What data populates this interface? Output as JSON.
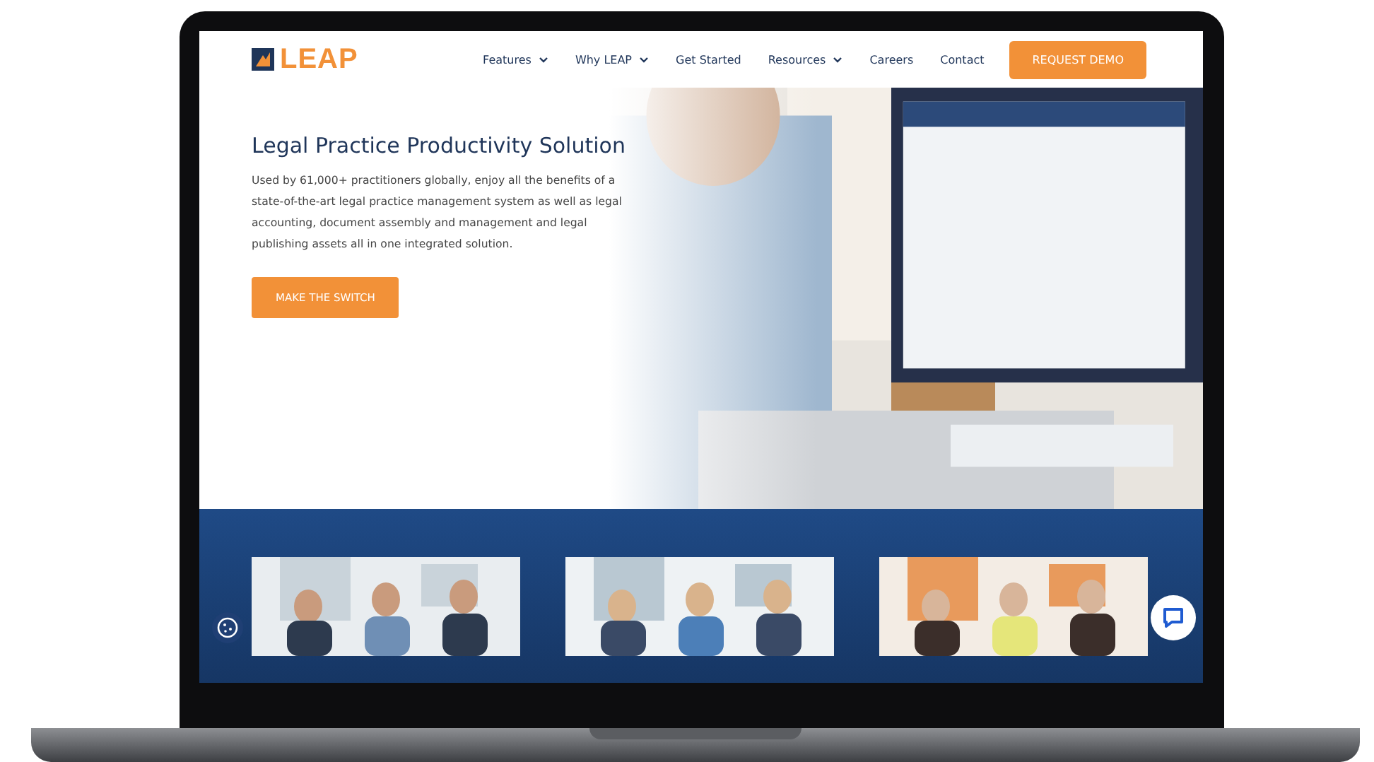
{
  "logo": {
    "text": "LEAP"
  },
  "nav": {
    "items": [
      {
        "label": "Features",
        "dropdown": true
      },
      {
        "label": "Why LEAP",
        "dropdown": true
      },
      {
        "label": "Get Started",
        "dropdown": false
      },
      {
        "label": "Resources",
        "dropdown": true
      },
      {
        "label": "Careers",
        "dropdown": false
      },
      {
        "label": "Contact",
        "dropdown": false
      }
    ],
    "cta": "REQUEST DEMO"
  },
  "hero": {
    "title": "Legal Practice Productivity Solution",
    "text": "Used by 61,000+ practitioners globally, enjoy all the benefits of a state-of-the-art legal practice management system as well as legal accounting, document assembly and management and legal publishing assets all in one integrated solution.",
    "button": "MAKE THE SWITCH"
  }
}
